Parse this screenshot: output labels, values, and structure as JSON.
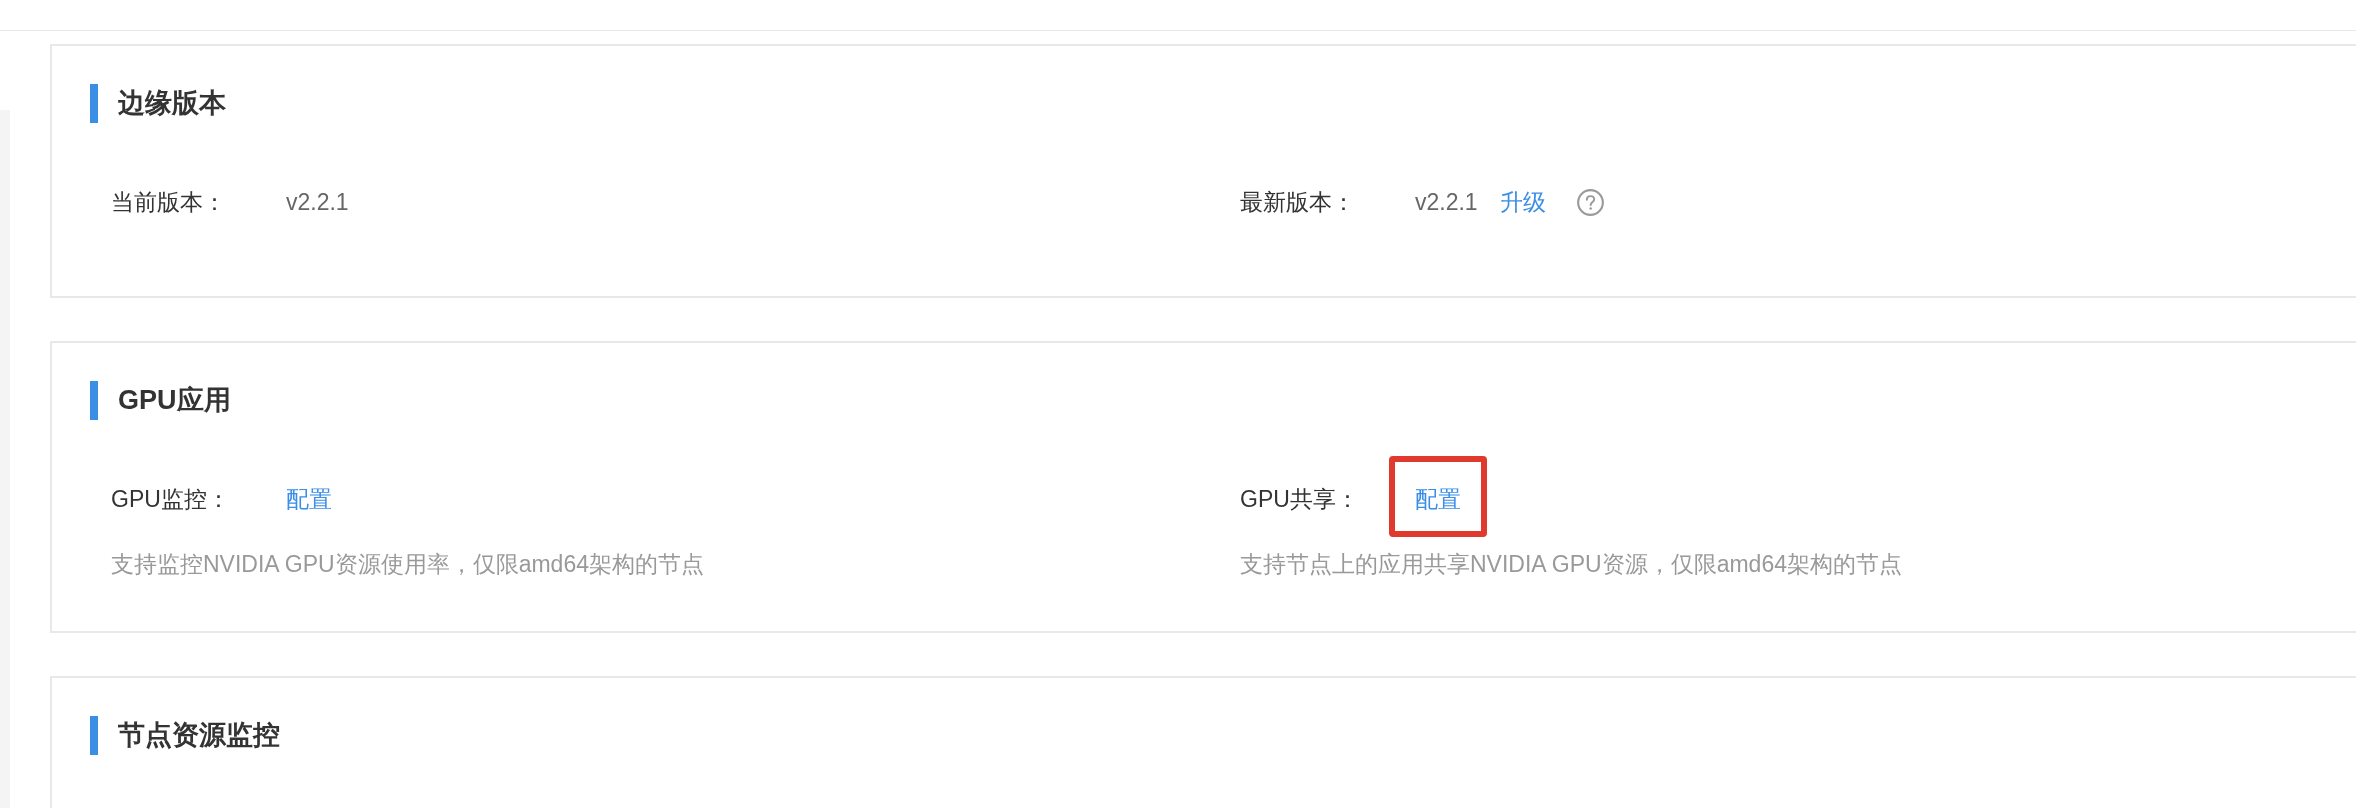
{
  "sections": [
    {
      "title": "边缘版本",
      "fields": [
        {
          "kind": "text",
          "label": "当前版本：",
          "value": "v2.2.1",
          "help": false
        },
        {
          "kind": "text",
          "label": "最新版本：",
          "value": "v2.2.1",
          "action": "升级",
          "help": true
        }
      ]
    },
    {
      "title": "GPU应用",
      "fields": [
        {
          "kind": "link",
          "label": "GPU监控：",
          "value": "配置",
          "description": "支持监控NVIDIA GPU资源使用率，仅限amd64架构的节点",
          "highlighted": false
        },
        {
          "kind": "link",
          "label": "GPU共享：",
          "value": "配置",
          "description": "支持节点上的应用共享NVIDIA GPU资源，仅限amd64架构的节点",
          "highlighted": true
        }
      ]
    },
    {
      "title": "节点资源监控"
    }
  ]
}
